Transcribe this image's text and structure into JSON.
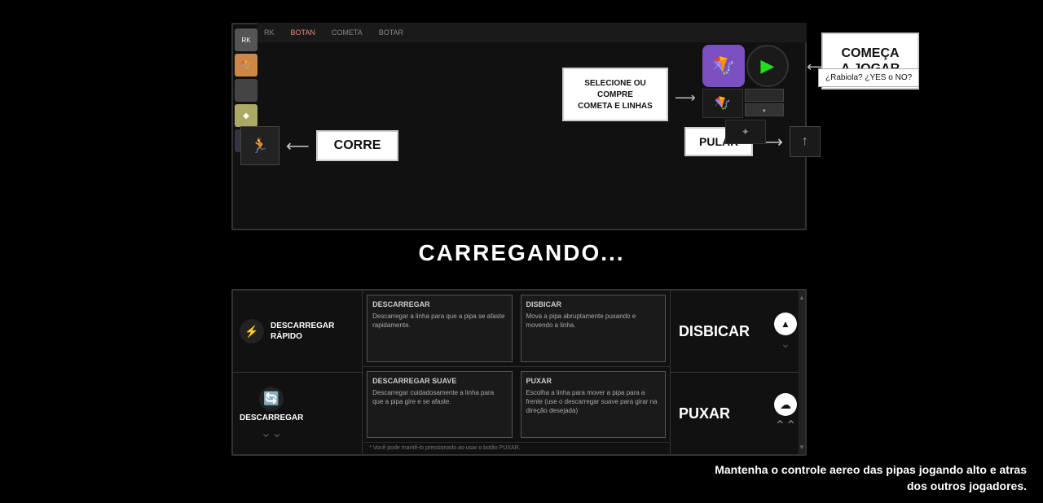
{
  "game_panel": {
    "nav_items": [
      "RK",
      "BOTAN",
      "COMETA",
      "BOTAR"
    ],
    "corre_label": "CORRE",
    "pular_label": "PULAR",
    "select_cometa": "SELECIONE OU COMPRE\nCOMETA E LINHAS",
    "start_btn_line1": "COMEÇA",
    "start_btn_line2": "A JOGAR",
    "rabiola_text": "¿Rabiola? ¿YES o NO?"
  },
  "loading": {
    "text": "CARREGANDO..."
  },
  "bottom_panel": {
    "left_items": [
      {
        "label": "DESCARREGAR\nRÁPIDO",
        "icon": "⚡"
      },
      {
        "label": "DESCARREGAR",
        "icon": "🔄"
      }
    ],
    "cards": [
      {
        "title": "DESCARREGAR",
        "text": "Descarregar a linha para que a pipa se afaste rapidamente."
      },
      {
        "title": "DISBICAR",
        "text": "Mova a pipa abruptamente puxando e movendo a linha."
      },
      {
        "title": "DESCARREGAR SUAVE",
        "text": "Descarregar cuidadosamente a linha para que a pipa gire e se afaste."
      },
      {
        "title": "PUXAR",
        "text": "Escolha a linha para mover a pipa para a frente (use o descarregar suave para girar na direção desejada)"
      }
    ],
    "note": "* Você pode mantê-lo pressionado ao usar o botão PUXAR.",
    "right_items": [
      {
        "label": "DISBICAR"
      },
      {
        "label": "PUXAR"
      }
    ]
  },
  "bottom_text_line1": "Mantenha o controle aereo das pipas jogando alto e atras",
  "bottom_text_line2": "dos outros jogadores."
}
